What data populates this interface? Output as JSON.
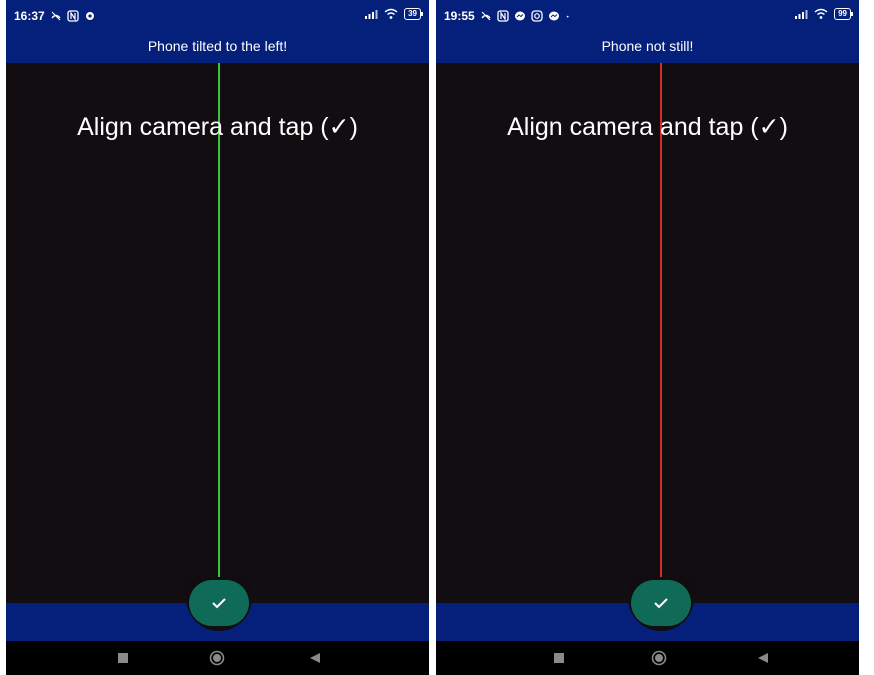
{
  "screens": [
    {
      "status": {
        "time": "16:37",
        "battery": "39"
      },
      "toast": "Phone tilted to the left!",
      "instruction": "Align camera and tap (✓)",
      "guide_line_color": "#3cc23c",
      "guide_state": "level-ok"
    },
    {
      "status": {
        "time": "19:55",
        "battery": "99"
      },
      "toast": "Phone not still!",
      "instruction": "Align camera and tap (✓)",
      "guide_line_color": "#d62b2b",
      "guide_state": "not-ready"
    }
  ],
  "icons": {
    "status": [
      "call-off-icon",
      "nfc-icon",
      "settings-icon",
      "messenger-icon",
      "instagram-icon",
      "signal-icon",
      "wifi-icon",
      "battery-icon"
    ],
    "fab": "check-icon",
    "nav": [
      "recents-square-icon",
      "home-circle-icon",
      "back-triangle-icon"
    ]
  },
  "colors": {
    "app_bar": "#04207a",
    "camera_bg": "#100c0f",
    "fab": "#106a58",
    "navbar": "#000000"
  }
}
